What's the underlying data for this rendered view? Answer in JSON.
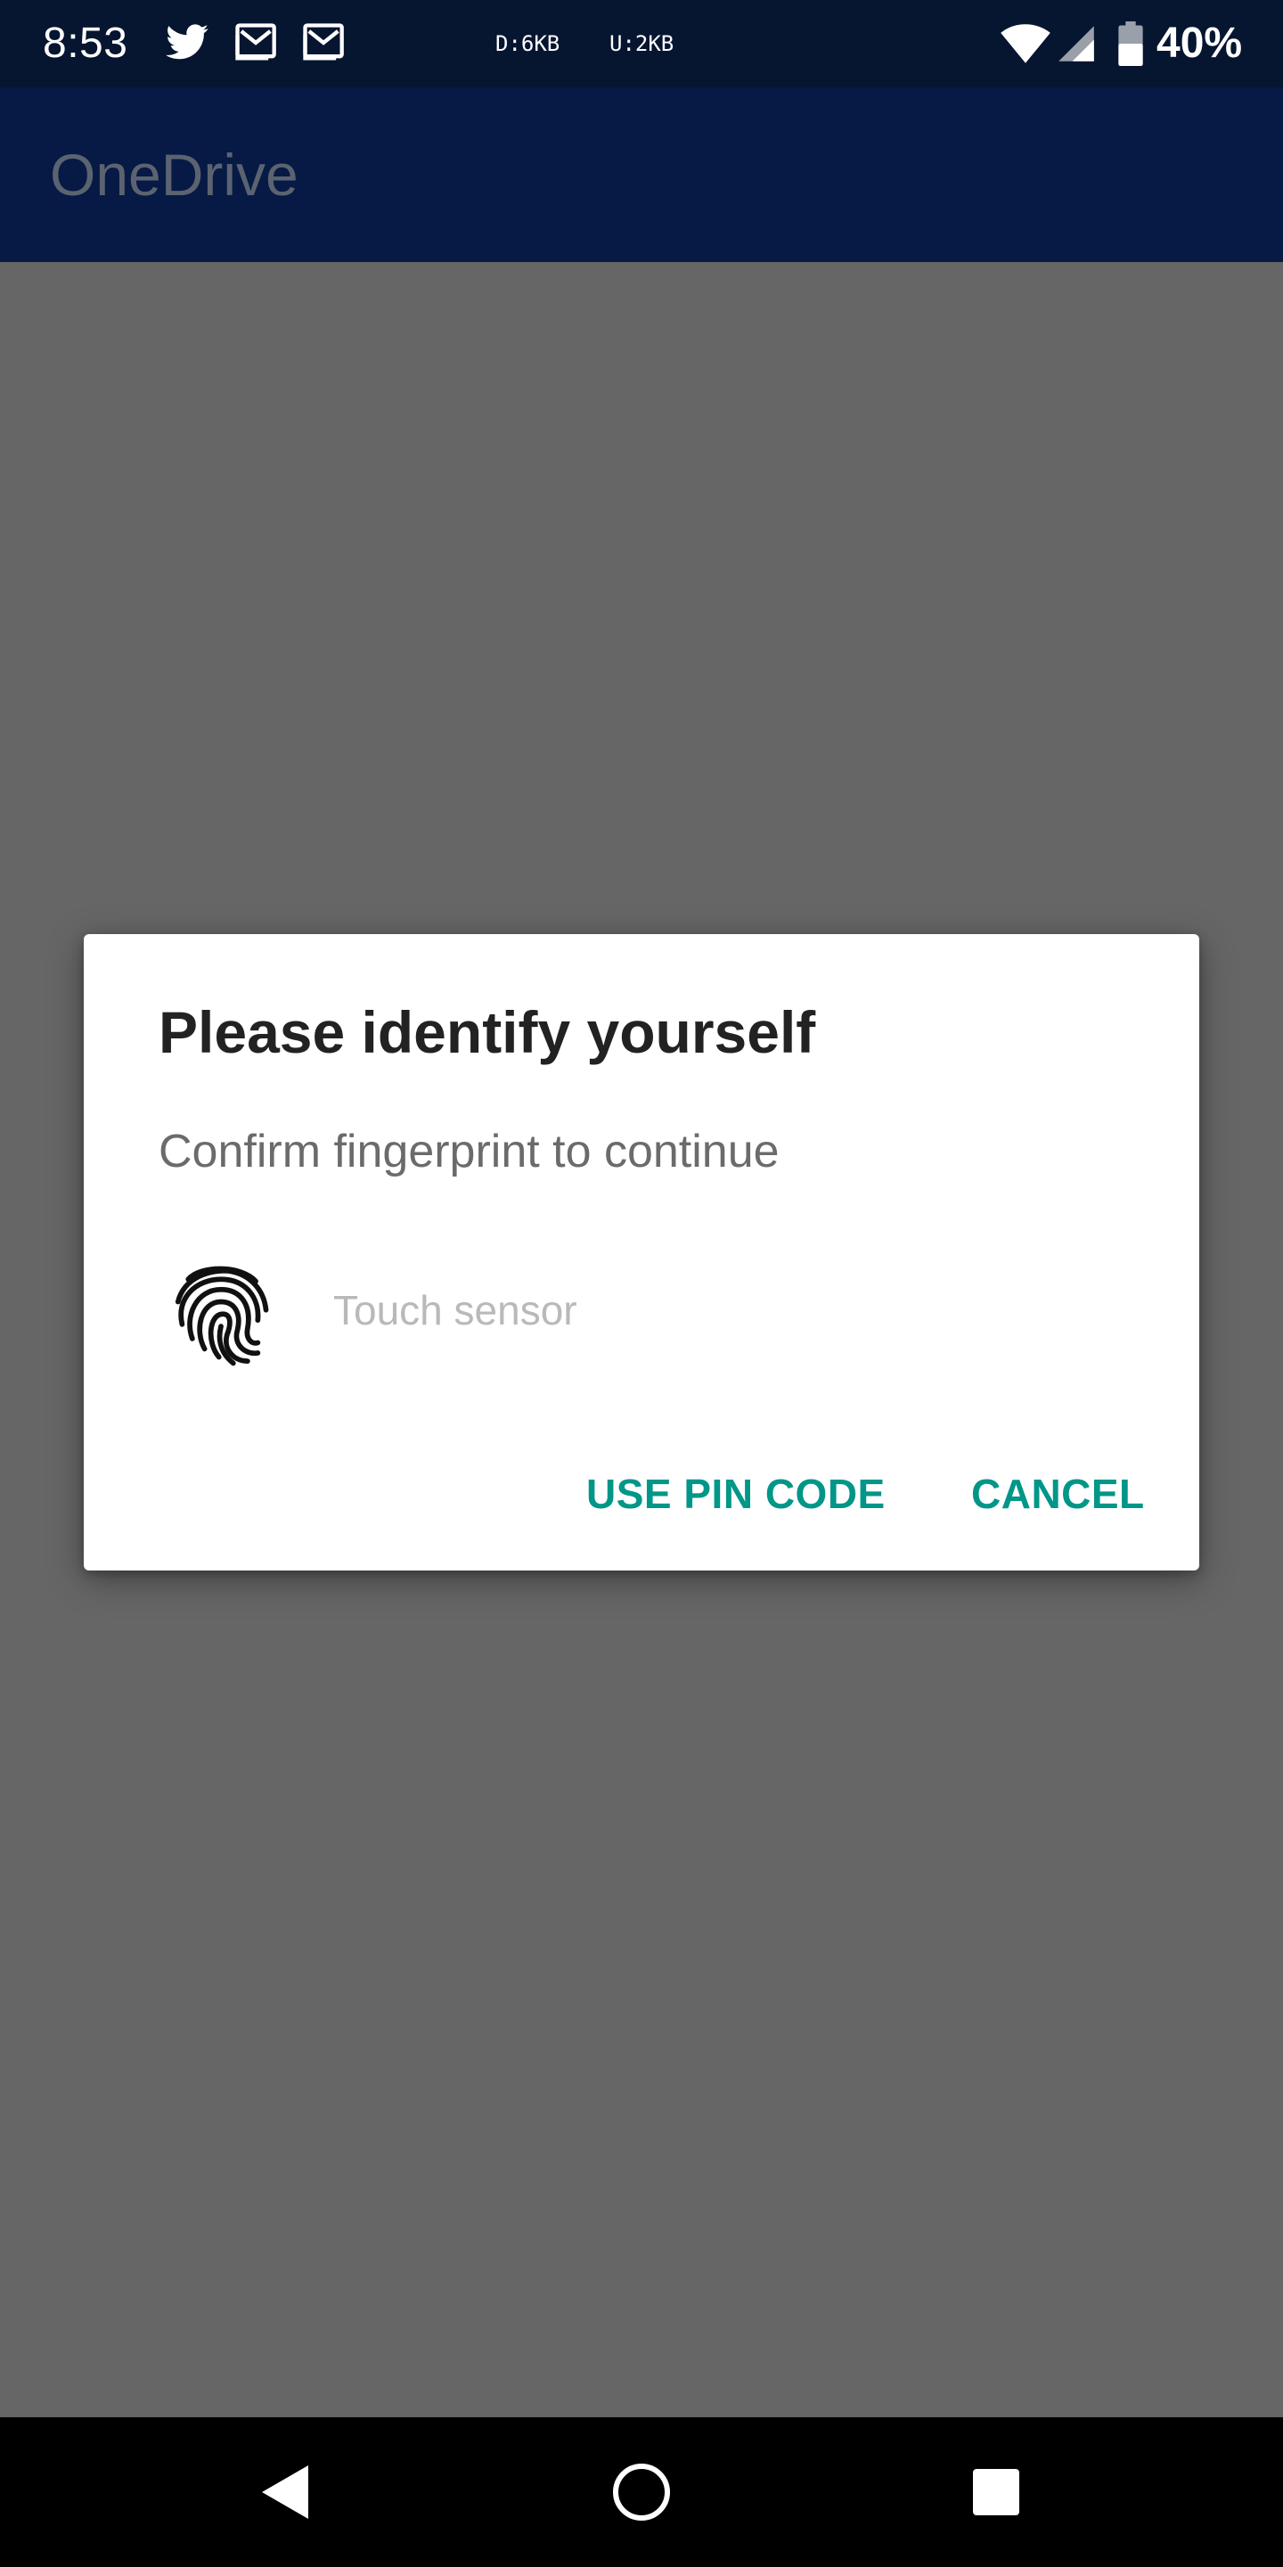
{
  "status_bar": {
    "time": "8:53",
    "notification_icons": [
      "twitter-icon",
      "gmail-icon",
      "gmail-icon"
    ],
    "download_speed": "D:6KB",
    "upload_speed": "U:2KB",
    "battery_percent": "40%",
    "battery_level": 0.4
  },
  "app_bar": {
    "title": "OneDrive"
  },
  "dialog": {
    "title": "Please identify yourself",
    "message": "Confirm fingerprint to continue",
    "sensor_hint": "Touch sensor",
    "buttons": {
      "use_pin": "USE PIN CODE",
      "cancel": "CANCEL"
    }
  },
  "navigation": {
    "buttons": [
      "back-icon",
      "home-icon",
      "recents-icon"
    ]
  },
  "colors": {
    "status_bar": "#061530",
    "app_bar": "#061a45",
    "scrim": "#666666",
    "accent": "#009688"
  }
}
